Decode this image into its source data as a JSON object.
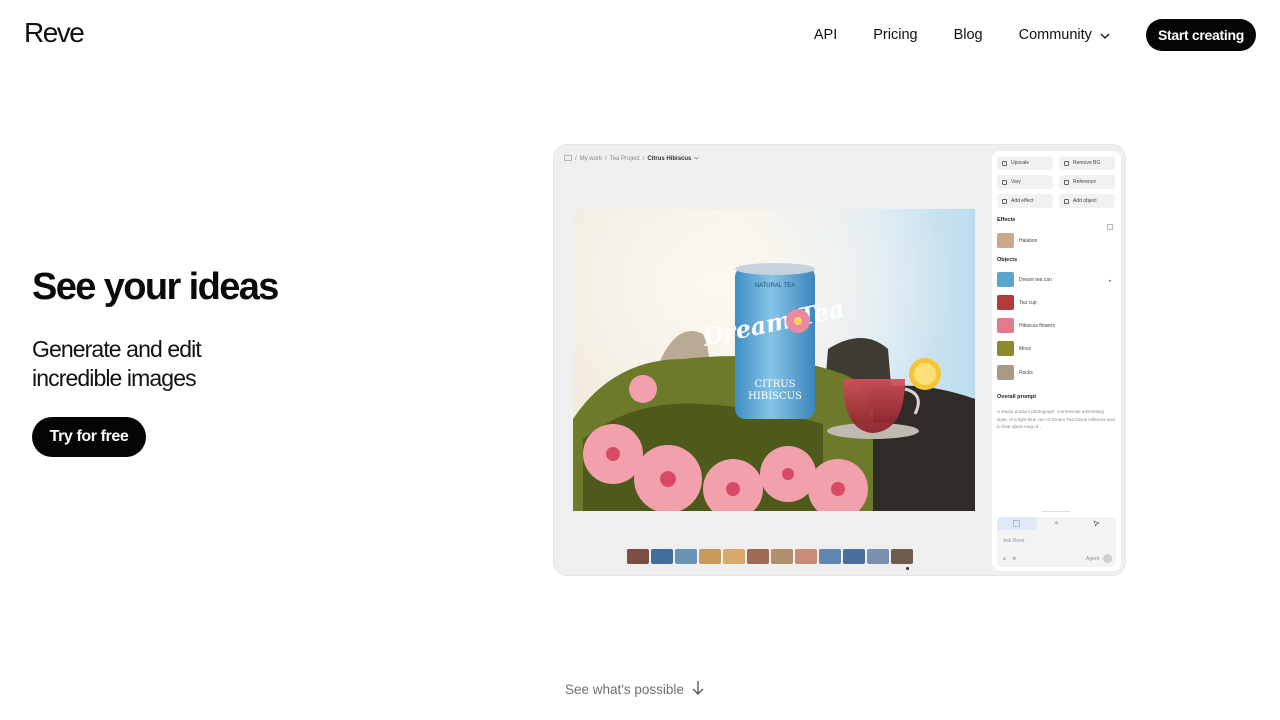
{
  "brand": {
    "logo": "Reve"
  },
  "nav": {
    "links": [
      "API",
      "Pricing",
      "Blog",
      "Community"
    ],
    "cta": "Start creating"
  },
  "hero": {
    "title": "See your ideas",
    "subtitle_line1": "Generate and edit",
    "subtitle_line2": "incredible images",
    "button": "Try for free"
  },
  "preview": {
    "breadcrumb": {
      "root": "My work",
      "project": "Tea Project",
      "current": "Citrus Hibiscus"
    },
    "tools": [
      "Upscale",
      "Remove BG",
      "Vary",
      "Reference",
      "Add effect",
      "Add object"
    ],
    "effects_label": "Effects",
    "effects": [
      {
        "label": "Halation",
        "color": "#c9a98a"
      }
    ],
    "objects_label": "Objects",
    "objects": [
      {
        "label": "Dream tea can",
        "color": "#5aa6cf"
      },
      {
        "label": "Tea cup",
        "color": "#b23a3a"
      },
      {
        "label": "Hibiscus flowers",
        "color": "#e57a8c"
      },
      {
        "label": "Moss",
        "color": "#8d8a2e"
      },
      {
        "label": "Rocks",
        "color": "#a89a86"
      }
    ],
    "prompt_label": "Overall prompt",
    "prompt_text": "A studio product photograph, commercial advertising style, of a light blue can of Dream Tea Citrus Hibiscus and a clear glass mug of...",
    "ask_placeholder": "Ask Reve",
    "agent_label": "Agent",
    "can_text": {
      "top": "NATURAL TEA",
      "brand": "Dream Tea",
      "flavor1": "CITRUS",
      "flavor2": "HIBISCUS"
    },
    "thumbnail_colors": [
      "#7a4d45",
      "#3f6f9a",
      "#6a93b3",
      "#c79a5b",
      "#d9a96b",
      "#9e6a55",
      "#b08f6f",
      "#c98b7a",
      "#5f86b0",
      "#4a6f9c",
      "#7d8fb0",
      "#6f5b4e"
    ]
  },
  "footer": {
    "see_more": "See what's possible"
  }
}
